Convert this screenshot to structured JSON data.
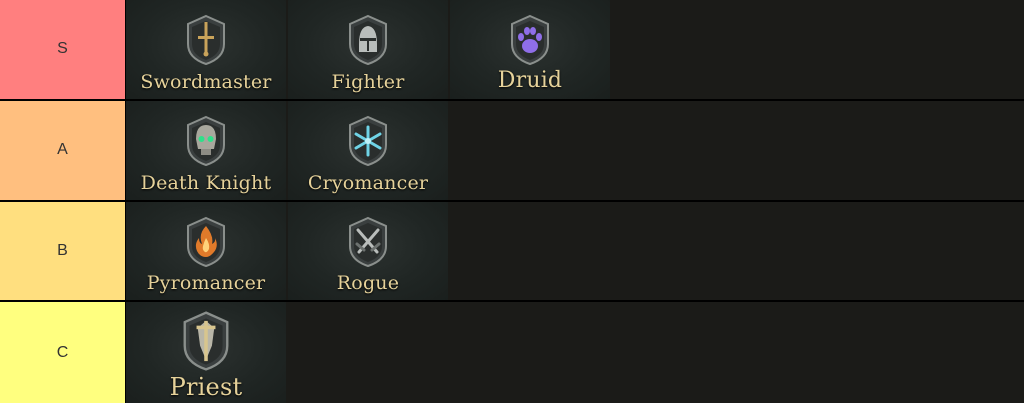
{
  "tiers": [
    {
      "label": "S",
      "color": "#ff7f7f",
      "items": [
        {
          "name": "Swordmaster",
          "icon": "sword-emblem-icon"
        },
        {
          "name": "Fighter",
          "icon": "helmet-emblem-icon"
        },
        {
          "name": "Druid",
          "icon": "paw-emblem-icon"
        }
      ]
    },
    {
      "label": "A",
      "color": "#ffbf7f",
      "items": [
        {
          "name": "Death Knight",
          "icon": "skull-emblem-icon"
        },
        {
          "name": "Cryomancer",
          "icon": "snowflake-emblem-icon"
        }
      ]
    },
    {
      "label": "B",
      "color": "#ffdf7f",
      "items": [
        {
          "name": "Pyromancer",
          "icon": "flame-emblem-icon"
        },
        {
          "name": "Rogue",
          "icon": "crossed-daggers-emblem-icon"
        }
      ]
    },
    {
      "label": "C",
      "color": "#ffff7f",
      "items": [
        {
          "name": "Priest",
          "icon": "mace-emblem-icon"
        }
      ]
    }
  ]
}
